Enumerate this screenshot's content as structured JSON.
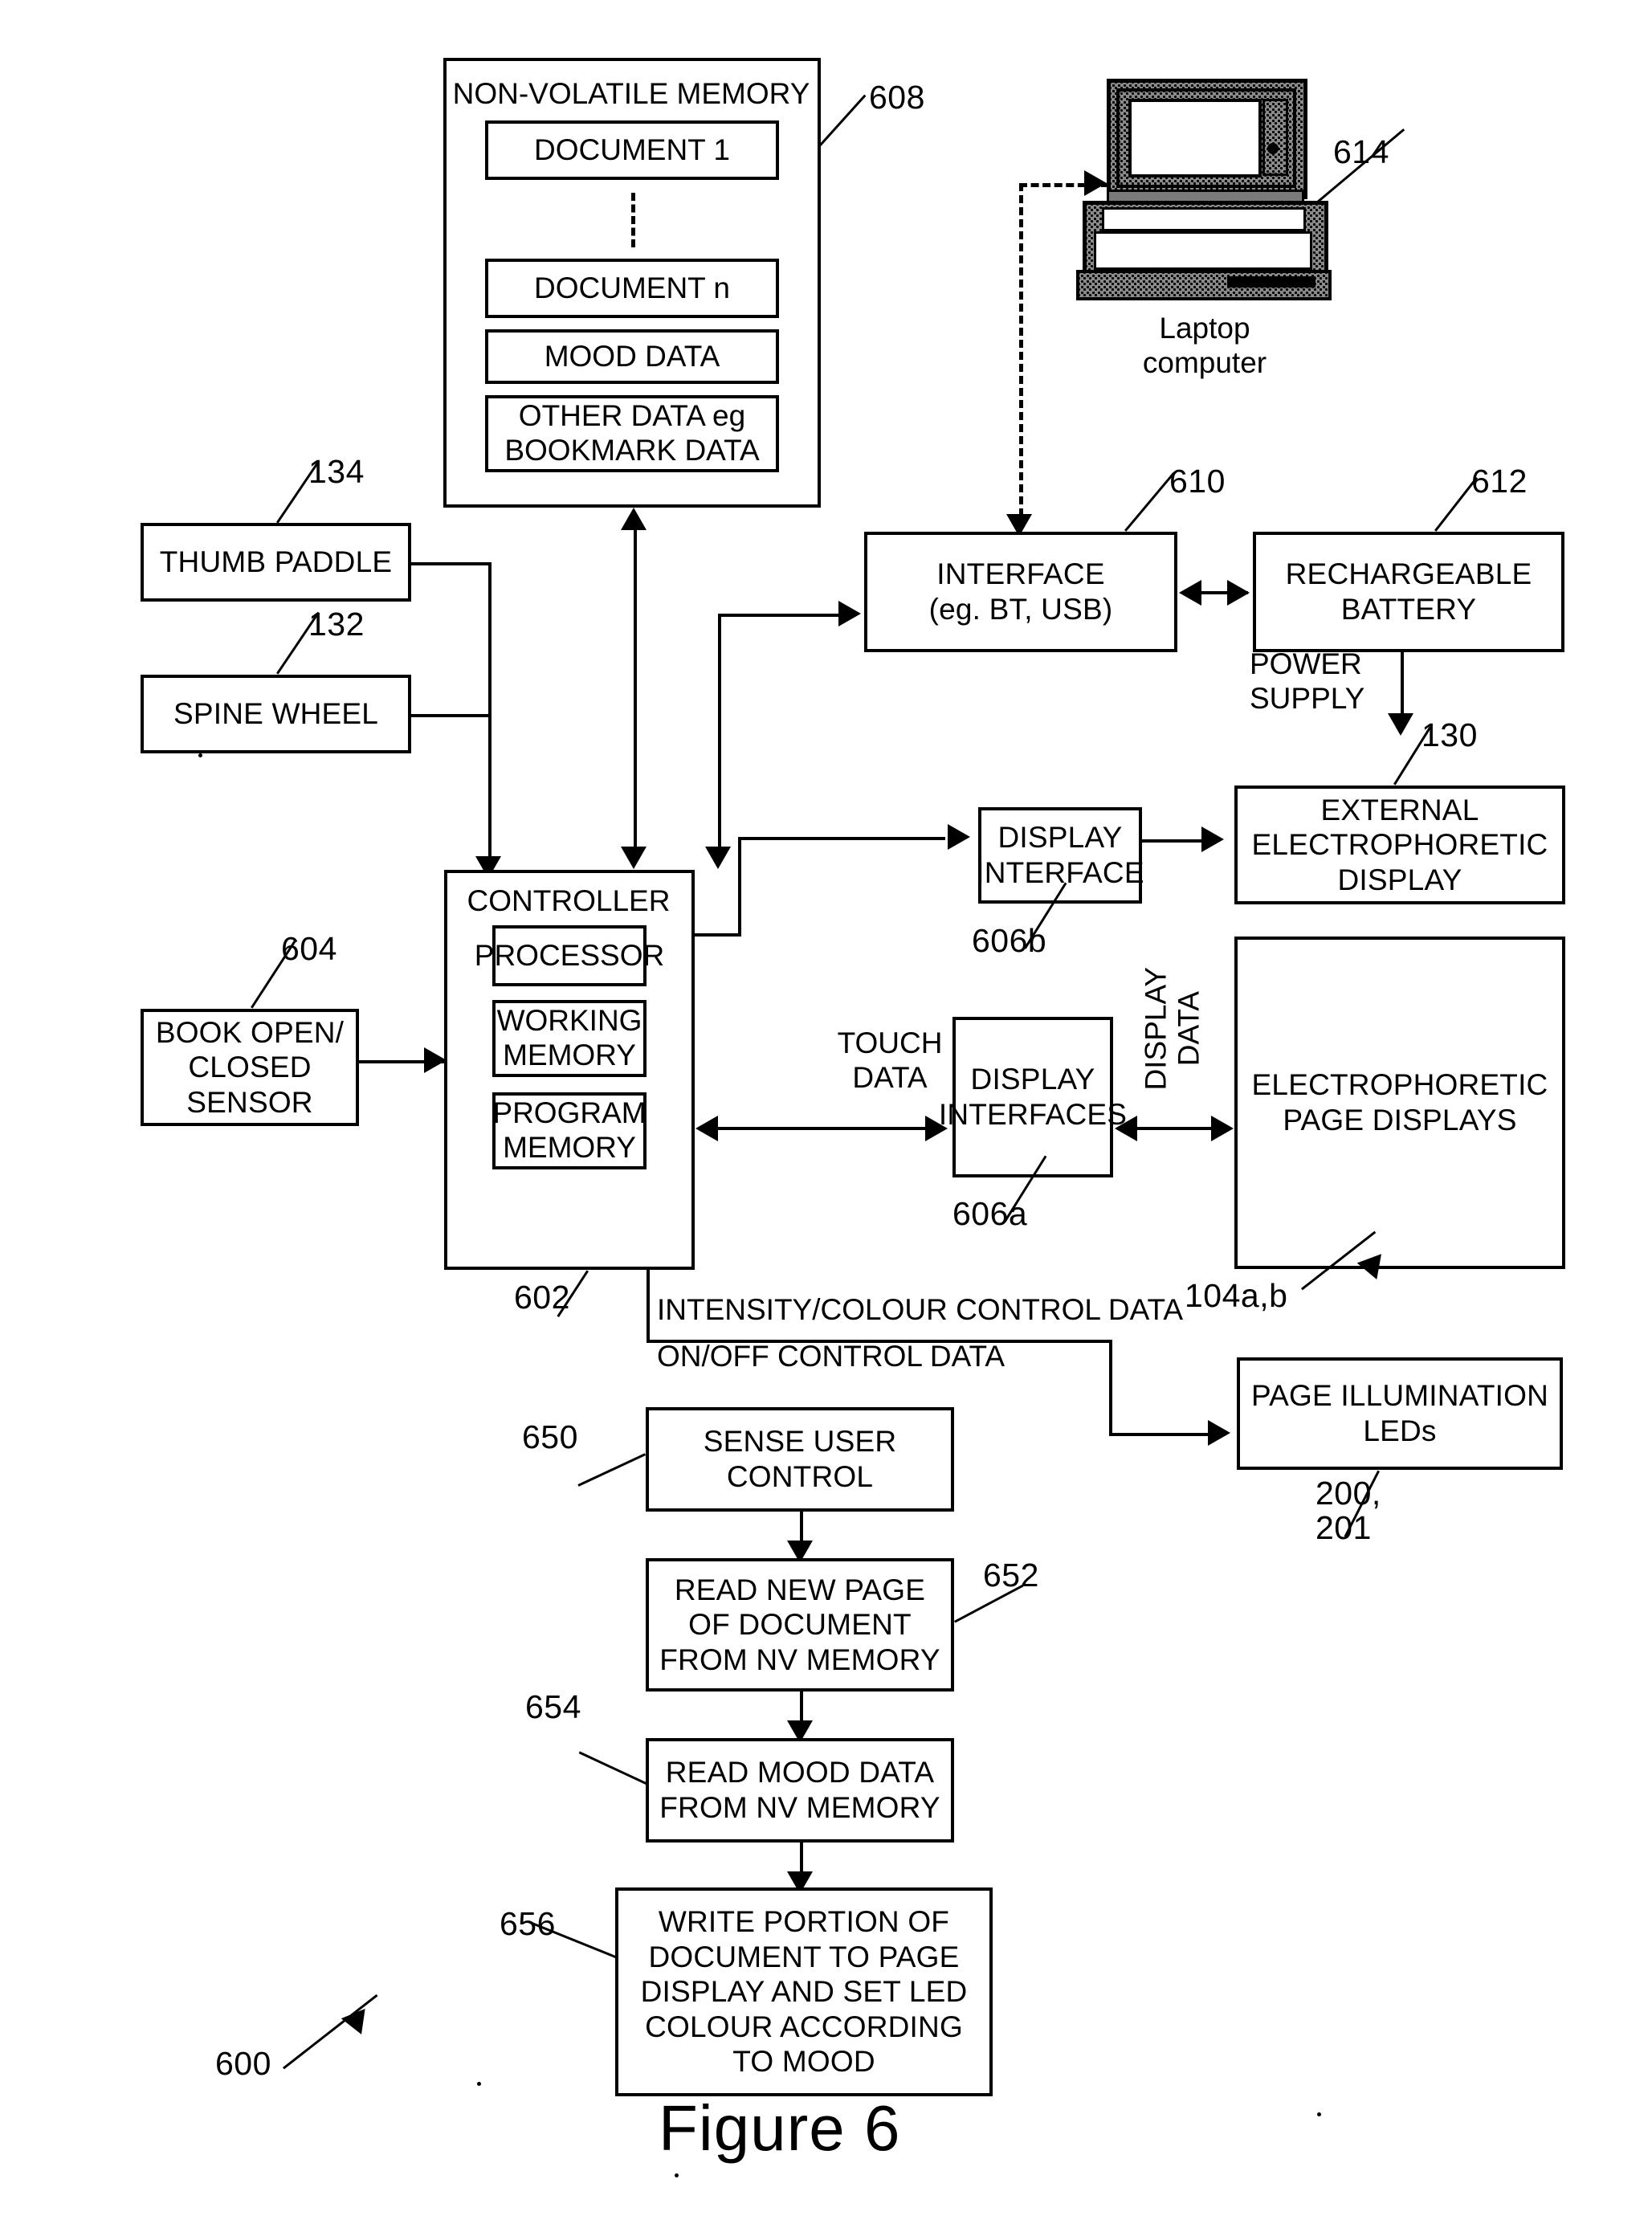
{
  "figure": {
    "caption": "Figure 6",
    "system_ref": "600"
  },
  "blocks": {
    "non_volatile_memory": {
      "title": "NON-VOLATILE MEMORY",
      "ref": "608",
      "items": [
        {
          "label": "DOCUMENT 1"
        },
        {
          "label": "DOCUMENT n"
        },
        {
          "label": "MOOD DATA"
        },
        {
          "label": "OTHER DATA eg\nBOOKMARK DATA"
        }
      ]
    },
    "laptop": {
      "label": "Laptop\ncomputer",
      "ref": "614"
    },
    "interface": {
      "label": "INTERFACE\n(eg. BT, USB)",
      "ref": "610"
    },
    "battery": {
      "label": "RECHARGEABLE\nBATTERY",
      "ref": "612"
    },
    "power_supply_label": "POWER\nSUPPLY",
    "thumb_paddle": {
      "label": "THUMB PADDLE",
      "ref": "134"
    },
    "spine_wheel": {
      "label": "SPINE WHEEL",
      "ref": "132"
    },
    "book_sensor": {
      "label": "BOOK OPEN/\nCLOSED\nSENSOR",
      "ref": "604"
    },
    "controller": {
      "title": "CONTROLLER",
      "ref": "602",
      "items": [
        {
          "label": "PROCESSOR"
        },
        {
          "label": "WORKING\nMEMORY"
        },
        {
          "label": "PROGRAM\nMEMORY"
        }
      ]
    },
    "display_interface_b": {
      "label": "DISPLAY\nINTERFACE",
      "ref": "606b"
    },
    "external_display": {
      "label": "EXTERNAL\nELECTROPHORETIC\nDISPLAY",
      "ref": "130"
    },
    "display_interfaces_a": {
      "label": "DISPLAY\nINTERFACES",
      "ref": "606a"
    },
    "page_displays": {
      "label": "ELECTROPHORETIC\nPAGE DISPLAYS",
      "ref": "104a,b"
    },
    "page_leds": {
      "label": "PAGE ILLUMINATION\nLEDs",
      "ref": "200,\n201"
    }
  },
  "signal_labels": {
    "touch_data": "TOUCH\nDATA",
    "display_data": "DISPLAY\nDATA",
    "intensity_colour": "INTENSITY/COLOUR CONTROL DATA",
    "on_off": "ON/OFF CONTROL DATA"
  },
  "flowchart": [
    {
      "ref": "650",
      "label": "SENSE USER\nCONTROL"
    },
    {
      "ref": "652",
      "label": "READ NEW PAGE\nOF DOCUMENT\nFROM NV MEMORY"
    },
    {
      "ref": "654",
      "label": "READ MOOD DATA\nFROM NV MEMORY"
    },
    {
      "ref": "656",
      "label": "WRITE PORTION OF\nDOCUMENT TO PAGE\nDISPLAY AND SET LED\nCOLOUR ACCORDING\nTO MOOD"
    }
  ],
  "colors": {
    "ink": "#000000",
    "paper": "#ffffff"
  }
}
